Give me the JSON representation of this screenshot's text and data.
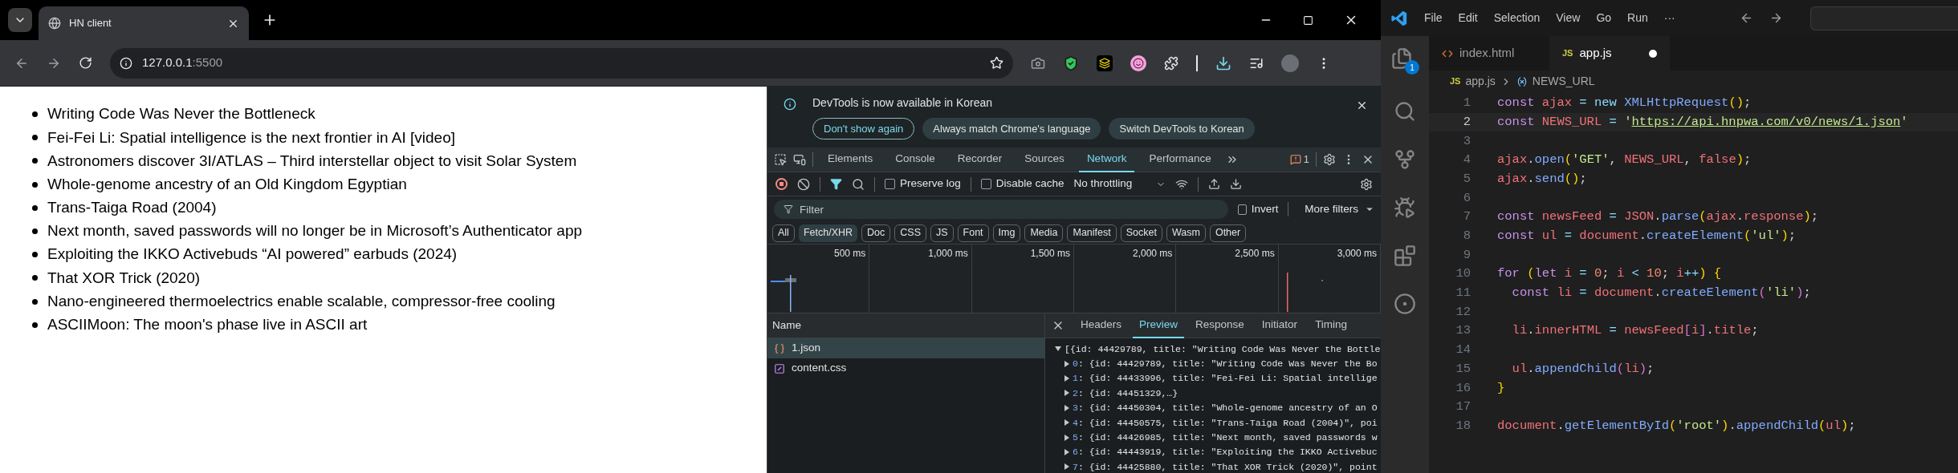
{
  "browser": {
    "tab": {
      "title": "HN client"
    },
    "address": {
      "host": "127.0.0.1",
      "port": ":5500"
    },
    "page": {
      "items": [
        "Writing Code Was Never the Bottleneck",
        "Fei-Fei Li: Spatial intelligence is the next frontier in AI [video]",
        "Astronomers discover 3I/ATLAS – Third interstellar object to visit Solar System",
        "Whole-genome ancestry of an Old Kingdom Egyptian",
        "Trans-Taiga Road (2004)",
        "Next month, saved passwords will no longer be in Microsoft’s Authenticator app",
        "Exploiting the IKKO Activebuds “AI powered” earbuds (2024)",
        "That XOR Trick (2020)",
        "Nano-engineered thermoelectrics enable scalable, compressor-free cooling",
        "ASCIIMoon: The moon's phase live in ASCII art"
      ]
    }
  },
  "devtools": {
    "notice": {
      "message": "DevTools is now available in Korean",
      "buttons": [
        {
          "label": "Don't show again",
          "kind": "outlined"
        },
        {
          "label": "Always match Chrome's language",
          "kind": "filled"
        },
        {
          "label": "Switch DevTools to Korean",
          "kind": "filled"
        }
      ]
    },
    "tabs": [
      {
        "label": "Elements",
        "selected": false
      },
      {
        "label": "Console",
        "selected": false
      },
      {
        "label": "Recorder",
        "selected": false
      },
      {
        "label": "Sources",
        "selected": false
      },
      {
        "label": "Network",
        "selected": true
      },
      {
        "label": "Performance",
        "selected": false
      }
    ],
    "issues_count": "1",
    "preserve_log": {
      "label": "Preserve log",
      "checked": false
    },
    "disable_cache": {
      "label": "Disable cache",
      "checked": false
    },
    "throttling": "No throttling",
    "filter": {
      "placeholder": "Filter"
    },
    "invert": {
      "label": "Invert",
      "checked": false
    },
    "more_filters": "More filters",
    "type_filters": [
      {
        "label": "All",
        "selected": false
      },
      {
        "label": "Fetch/XHR",
        "selected": true
      },
      {
        "label": "Doc",
        "selected": false
      },
      {
        "label": "CSS",
        "selected": false
      },
      {
        "label": "JS",
        "selected": false
      },
      {
        "label": "Font",
        "selected": false
      },
      {
        "label": "Img",
        "selected": false
      },
      {
        "label": "Media",
        "selected": false
      },
      {
        "label": "Manifest",
        "selected": false
      },
      {
        "label": "Socket",
        "selected": false
      },
      {
        "label": "Wasm",
        "selected": false
      },
      {
        "label": "Other",
        "selected": false
      }
    ],
    "timeline_ticks": [
      "500 ms",
      "1,000 ms",
      "1,500 ms",
      "2,000 ms",
      "2,500 ms",
      "3,000 ms"
    ],
    "requests_column": "Name",
    "requests": [
      {
        "name": "1.json",
        "kind": "json",
        "selected": true
      },
      {
        "name": "content.css",
        "kind": "css",
        "selected": false
      }
    ],
    "detail_tabs": [
      {
        "label": "Headers",
        "selected": false
      },
      {
        "label": "Preview",
        "selected": true
      },
      {
        "label": "Response",
        "selected": false
      },
      {
        "label": "Initiator",
        "selected": false
      },
      {
        "label": "Timing",
        "selected": false
      }
    ],
    "preview": [
      {
        "text": "[{id: 44429789, title: \"Writing Code Was Never the Bottle",
        "expanded": true
      },
      {
        "index": "0",
        "text": ": {id: 44429789, title: \"Writing Code Was Never the Bo",
        "expanded": false
      },
      {
        "index": "1",
        "text": ": {id: 44433996, title: \"Fei-Fei Li: Spatial intellige",
        "expanded": false
      },
      {
        "index": "2",
        "text": ": {id: 44451329,…}",
        "expanded": false
      },
      {
        "index": "3",
        "text": ": {id: 44450304, title: \"Whole-genome ancestry of an O",
        "expanded": false
      },
      {
        "index": "4",
        "text": ": {id: 44450575, title: \"Trans-Taiga Road (2004)\", poi",
        "expanded": false
      },
      {
        "index": "5",
        "text": ": {id: 44426985, title: \"Next month, saved passwords w",
        "expanded": false
      },
      {
        "index": "6",
        "text": ": {id: 44443919, title: \"Exploiting the IKKO Activebuc",
        "expanded": false
      },
      {
        "index": "7",
        "text": ": {id: 44425880, title: \"That XOR Trick (2020)\", point",
        "expanded": false
      }
    ]
  },
  "vscode": {
    "menu": [
      "File",
      "Edit",
      "Selection",
      "View",
      "Go",
      "Run",
      "···"
    ],
    "explorer_badge": "1",
    "tabs": [
      {
        "label": "index.html",
        "kind": "html",
        "selected": false,
        "modified": false
      },
      {
        "label": "app.js",
        "kind": "js",
        "badge": "JS",
        "selected": true,
        "modified": true
      }
    ],
    "breadcrumb": {
      "badge": "JS",
      "file": "app.js",
      "symbol": "NEWS_URL"
    },
    "lines": [
      {
        "number": "1",
        "selected": false,
        "tokens": [
          {
            "text": "const ",
            "kind": "keyword"
          },
          {
            "text": "ajax",
            "kind": "variable"
          },
          {
            "text": " = new ",
            "kind": "operator"
          },
          {
            "text": "XMLHttpRequest",
            "kind": "function"
          },
          {
            "text": "()",
            "kind": "bracket"
          },
          {
            "text": ";",
            "kind": "punctuation"
          }
        ]
      },
      {
        "number": "2",
        "selected": true,
        "tokens": [
          {
            "text": "const ",
            "kind": "keyword"
          },
          {
            "text": "NEWS_URL",
            "kind": "variable"
          },
          {
            "text": " = ",
            "kind": "operator"
          },
          {
            "text": "'",
            "kind": "string"
          },
          {
            "text": "https://api.hnpwa.com/v0/news/1.json",
            "kind": "link"
          },
          {
            "text": "'",
            "kind": "string"
          }
        ]
      },
      {
        "number": "3",
        "selected": false
      },
      {
        "number": "4",
        "selected": false,
        "tokens": [
          {
            "text": "ajax",
            "kind": "variable"
          },
          {
            "text": ".",
            "kind": "punctuation"
          },
          {
            "text": "open",
            "kind": "function"
          },
          {
            "text": "(",
            "kind": "bracket"
          },
          {
            "text": "'GET'",
            "kind": "string"
          },
          {
            "text": ", ",
            "kind": "punctuation"
          },
          {
            "text": "NEWS_URL",
            "kind": "variable"
          },
          {
            "text": ", ",
            "kind": "punctuation"
          },
          {
            "text": "false",
            "kind": "variable"
          },
          {
            "text": ")",
            "kind": "bracket"
          },
          {
            "text": ";",
            "kind": "punctuation"
          }
        ]
      },
      {
        "number": "5",
        "selected": false,
        "tokens": [
          {
            "text": "ajax",
            "kind": "variable"
          },
          {
            "text": ".",
            "kind": "punctuation"
          },
          {
            "text": "send",
            "kind": "function"
          },
          {
            "text": "()",
            "kind": "bracket"
          },
          {
            "text": ";",
            "kind": "punctuation"
          }
        ]
      },
      {
        "number": "6",
        "selected": false
      },
      {
        "number": "7",
        "selected": false,
        "tokens": [
          {
            "text": "const ",
            "kind": "keyword"
          },
          {
            "text": "newsFeed",
            "kind": "variable"
          },
          {
            "text": " = ",
            "kind": "operator"
          },
          {
            "text": "JSON",
            "kind": "variable"
          },
          {
            "text": ".",
            "kind": "punctuation"
          },
          {
            "text": "parse",
            "kind": "function"
          },
          {
            "text": "(",
            "kind": "bracket"
          },
          {
            "text": "ajax",
            "kind": "variable"
          },
          {
            "text": ".",
            "kind": "punctuation"
          },
          {
            "text": "response",
            "kind": "variable"
          },
          {
            "text": ")",
            "kind": "bracket"
          },
          {
            "text": ";",
            "kind": "punctuation"
          }
        ]
      },
      {
        "number": "8",
        "selected": false,
        "tokens": [
          {
            "text": "const ",
            "kind": "keyword"
          },
          {
            "text": "ul",
            "kind": "variable"
          },
          {
            "text": " = ",
            "kind": "operator"
          },
          {
            "text": "document",
            "kind": "variable"
          },
          {
            "text": ".",
            "kind": "punctuation"
          },
          {
            "text": "createElement",
            "kind": "function"
          },
          {
            "text": "(",
            "kind": "bracket"
          },
          {
            "text": "'ul'",
            "kind": "string"
          },
          {
            "text": ")",
            "kind": "bracket"
          },
          {
            "text": ";",
            "kind": "punctuation"
          }
        ]
      },
      {
        "number": "9",
        "selected": false
      },
      {
        "number": "10",
        "selected": false,
        "tokens": [
          {
            "text": "for ",
            "kind": "keyword"
          },
          {
            "text": "(",
            "kind": "bracket"
          },
          {
            "text": "let ",
            "kind": "keyword"
          },
          {
            "text": "i",
            "kind": "variable"
          },
          {
            "text": " = ",
            "kind": "operator"
          },
          {
            "text": "0",
            "kind": "number"
          },
          {
            "text": "; ",
            "kind": "punctuation"
          },
          {
            "text": "i",
            "kind": "variable"
          },
          {
            "text": " < ",
            "kind": "operator"
          },
          {
            "text": "10",
            "kind": "number"
          },
          {
            "text": "; ",
            "kind": "punctuation"
          },
          {
            "text": "i",
            "kind": "variable"
          },
          {
            "text": "++",
            "kind": "operator"
          },
          {
            "text": ") {",
            "kind": "bracket"
          }
        ]
      },
      {
        "number": "11",
        "selected": false,
        "tokens": [
          {
            "text": "  const ",
            "kind": "keyword"
          },
          {
            "text": "li",
            "kind": "variable"
          },
          {
            "text": " = ",
            "kind": "operator"
          },
          {
            "text": "document",
            "kind": "variable"
          },
          {
            "text": ".",
            "kind": "punctuation"
          },
          {
            "text": "createElement",
            "kind": "function"
          },
          {
            "text": "(",
            "kind": "bracket2"
          },
          {
            "text": "'li'",
            "kind": "string"
          },
          {
            "text": ")",
            "kind": "bracket2"
          },
          {
            "text": ";",
            "kind": "punctuation"
          }
        ]
      },
      {
        "number": "12",
        "selected": false
      },
      {
        "number": "13",
        "selected": false,
        "tokens": [
          {
            "text": "  li",
            "kind": "variable"
          },
          {
            "text": ".",
            "kind": "punctuation"
          },
          {
            "text": "innerHTML",
            "kind": "variable"
          },
          {
            "text": " = ",
            "kind": "operator"
          },
          {
            "text": "newsFeed",
            "kind": "variable"
          },
          {
            "text": "[",
            "kind": "bracket2"
          },
          {
            "text": "i",
            "kind": "variable"
          },
          {
            "text": "]",
            "kind": "bracket2"
          },
          {
            "text": ".",
            "kind": "punctuation"
          },
          {
            "text": "title",
            "kind": "variable"
          },
          {
            "text": ";",
            "kind": "punctuation"
          }
        ]
      },
      {
        "number": "14",
        "selected": false
      },
      {
        "number": "15",
        "selected": false,
        "tokens": [
          {
            "text": "  ul",
            "kind": "variable"
          },
          {
            "text": ".",
            "kind": "punctuation"
          },
          {
            "text": "appendChild",
            "kind": "function"
          },
          {
            "text": "(",
            "kind": "bracket2"
          },
          {
            "text": "li",
            "kind": "variable"
          },
          {
            "text": ")",
            "kind": "bracket2"
          },
          {
            "text": ";",
            "kind": "punctuation"
          }
        ]
      },
      {
        "number": "16",
        "selected": false,
        "tokens": [
          {
            "text": "}",
            "kind": "bracket"
          }
        ]
      },
      {
        "number": "17",
        "selected": false
      },
      {
        "number": "18",
        "selected": false,
        "tokens": [
          {
            "text": "document",
            "kind": "variable"
          },
          {
            "text": ".",
            "kind": "punctuation"
          },
          {
            "text": "getElementById",
            "kind": "function"
          },
          {
            "text": "(",
            "kind": "bracket"
          },
          {
            "text": "'root'",
            "kind": "string"
          },
          {
            "text": ")",
            "kind": "bracket"
          },
          {
            "text": ".",
            "kind": "punctuation"
          },
          {
            "text": "appendChild",
            "kind": "function"
          },
          {
            "text": "(",
            "kind": "bracket"
          },
          {
            "text": "ul",
            "kind": "variable"
          },
          {
            "text": ")",
            "kind": "bracket"
          },
          {
            "text": ";",
            "kind": "punctuation"
          }
        ]
      }
    ]
  }
}
